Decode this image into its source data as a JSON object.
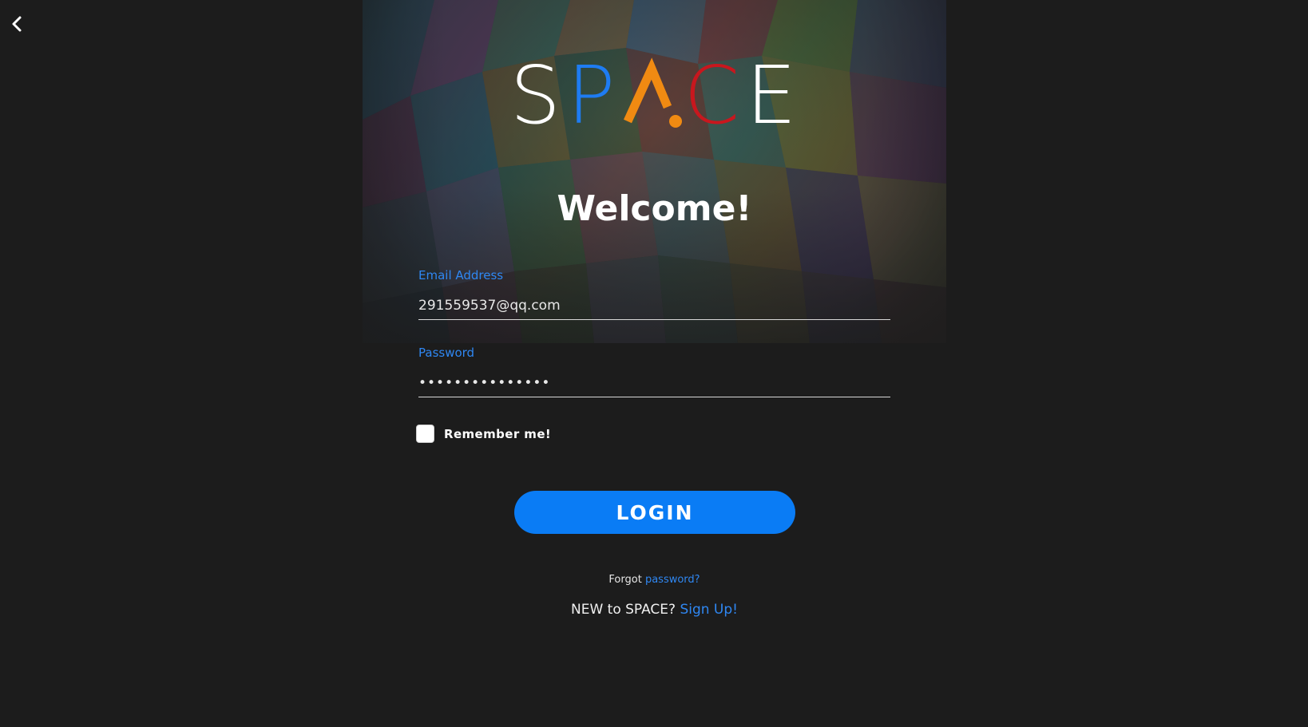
{
  "nav": {
    "back_icon": "chevron-left-icon"
  },
  "logo": {
    "letters": [
      "S",
      "P",
      "A",
      "C",
      "E"
    ],
    "colors": {
      "S": "#ffffff",
      "P": "#1e7cf2",
      "A": "#f08a12",
      "C": "#c8171e",
      "E": "#ffffff"
    }
  },
  "welcome": {
    "title": "Welcome!"
  },
  "form": {
    "email_label": "Email Address",
    "email_value": "291559537@qq.com",
    "password_label": "Password",
    "password_value": "•••••••••••••••",
    "remember_label": "Remember me!",
    "remember_checked": false,
    "login_label": "LOGIN"
  },
  "links": {
    "forgot_prefix": "Forgot",
    "forgot_link": "password?",
    "signup_prefix": "NEW to SPACE?",
    "signup_link": "Sign Up!"
  },
  "colors": {
    "background": "#1c1c1c",
    "accent_blue": "#0a7cf5",
    "label_blue": "#2f87f2"
  }
}
